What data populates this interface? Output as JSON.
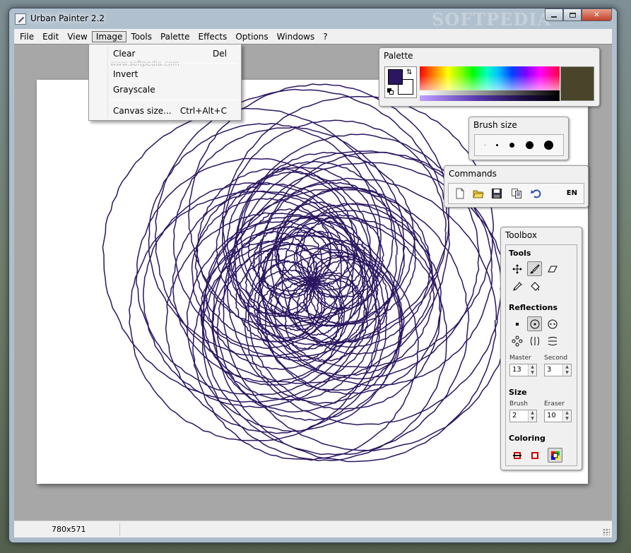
{
  "window": {
    "title": "Urban Painter 2.2",
    "watermark": "SOFTPEDIA",
    "controls": {
      "minimize": "minimize",
      "maximize": "maximize",
      "close": "✕"
    }
  },
  "menubar": {
    "items": [
      "File",
      "Edit",
      "View",
      "Image",
      "Tools",
      "Palette",
      "Effects",
      "Options",
      "Windows",
      "?"
    ],
    "active": "Image"
  },
  "image_menu": {
    "watermark": "www.softpedia.com",
    "items": [
      {
        "label": "Clear",
        "shortcut": "Del"
      },
      {
        "label": "Invert",
        "shortcut": ""
      },
      {
        "label": "Grayscale",
        "shortcut": ""
      },
      {
        "label": "Canvas size...",
        "shortcut": "Ctrl+Alt+C"
      }
    ]
  },
  "palette": {
    "title": "Palette",
    "foreground_color": "#2b1661",
    "background_color": "#ffffff",
    "preview_color": "#4a442a"
  },
  "brush_size": {
    "title": "Brush size",
    "sizes": [
      "size-1",
      "size-2",
      "size-3",
      "size-4",
      "size-5"
    ]
  },
  "commands": {
    "title": "Commands",
    "icons": [
      "new-file-icon",
      "open-folder-icon",
      "save-icon",
      "copy-icon",
      "undo-icon"
    ],
    "language": "EN"
  },
  "toolbox": {
    "title": "Toolbox",
    "tools_heading": "Tools",
    "tools": [
      "move-icon",
      "brush-icon",
      "eraser-icon",
      "eyedropper-icon",
      "fill-bucket-icon"
    ],
    "selected_tool": "brush-icon",
    "reflections_heading": "Reflections",
    "reflections": [
      "single-point-icon",
      "radial-icon",
      "dual-point-icon",
      "four-way-icon",
      "mirror-vertical-icon",
      "mirror-horizontal-icon"
    ],
    "selected_reflection": "radial-icon",
    "master_label": "Master",
    "master_value": "13",
    "second_label": "Second",
    "second_value": "3",
    "size_heading": "Size",
    "brush_label": "Brush",
    "brush_value": "2",
    "eraser_label": "Eraser",
    "eraser_value": "10",
    "coloring_heading": "Coloring",
    "coloring": [
      "solid-color-icon",
      "outline-color-icon",
      "rainbow-color-icon"
    ],
    "selected_coloring": "rainbow-color-icon"
  },
  "statusbar": {
    "canvas_size": "780x571"
  },
  "colors": {
    "stroke": "#2b1661",
    "canvas": "#ffffff",
    "workspace": "#a7a7a7"
  }
}
